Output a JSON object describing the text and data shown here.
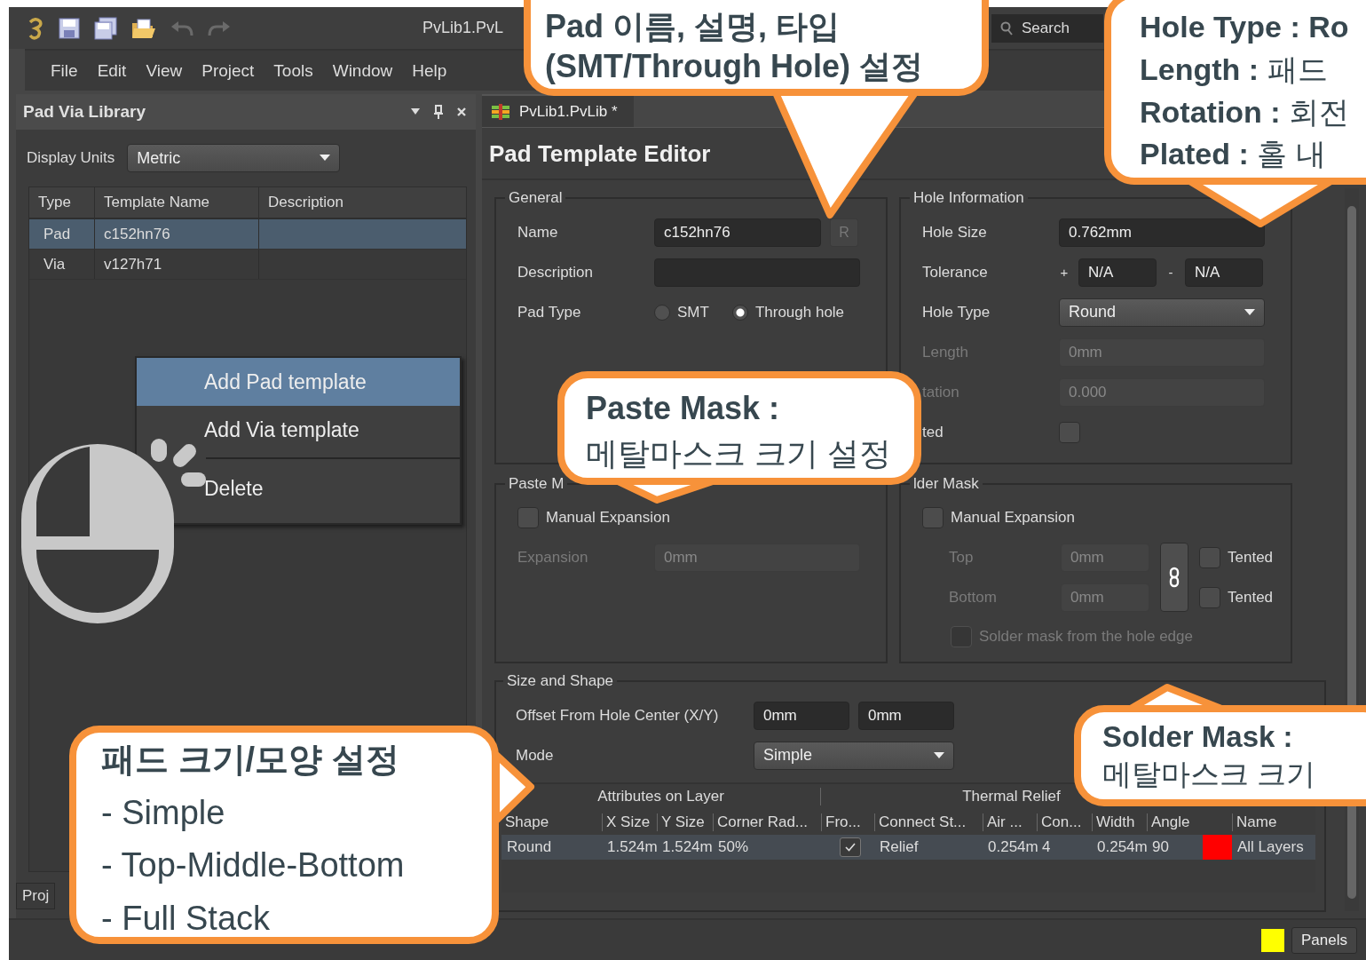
{
  "titlebar": {
    "title": "PvLib1.PvL",
    "search_placeholder": "Search"
  },
  "menu": [
    "File",
    "Edit",
    "View",
    "Project",
    "Tools",
    "Window",
    "Help"
  ],
  "panel": {
    "title": "Pad Via Library",
    "display_units_label": "Display Units",
    "display_units": "Metric",
    "columns": [
      "Type",
      "Template Name",
      "Description"
    ],
    "rows": [
      {
        "type": "Pad",
        "name": "c152hn76",
        "selected": true
      },
      {
        "type": "Via",
        "name": "v127h71",
        "selected": false
      }
    ],
    "bottom_tab": "Proj"
  },
  "context_menu": [
    {
      "label": "Add Pad template",
      "selected": true,
      "separator_before": false
    },
    {
      "label": "Add Via template",
      "selected": false,
      "separator_before": false
    },
    {
      "label": "Delete",
      "selected": false,
      "separator_before": true
    }
  ],
  "editor": {
    "tab": "PvLib1.PvLib *",
    "title": "Pad Template Editor",
    "general": {
      "title": "General",
      "name_label": "Name",
      "name": "c152hn76",
      "r_button": "R",
      "description_label": "Description",
      "pad_type_label": "Pad Type",
      "pad_types": [
        {
          "label": "SMT",
          "selected": false
        },
        {
          "label": "Through hole",
          "selected": true
        }
      ]
    },
    "hole": {
      "title": "Hole Information",
      "fields": [
        {
          "kind": "text",
          "label": "Hole Size",
          "value": "0.762mm",
          "disabled": false
        },
        {
          "kind": "tolerance",
          "label": "Tolerance",
          "plus": "+",
          "plus_value": "N/A",
          "minus": "-",
          "minus_value": "N/A"
        },
        {
          "kind": "dropdown",
          "label": "Hole Type",
          "value": "Round"
        },
        {
          "kind": "text",
          "label": "Length",
          "value": "0mm",
          "disabled": true
        },
        {
          "kind": "text",
          "label": "tation",
          "value": "0.000",
          "disabled": true
        },
        {
          "kind": "checkbox",
          "label": "ted",
          "checked": false
        }
      ]
    },
    "paste_mask": {
      "title": "Paste M",
      "manual_label": "Manual Expansion",
      "manual_checked": false,
      "expansion_label": "Expansion",
      "expansion": "0mm"
    },
    "solder_mask": {
      "title": "lder Mask",
      "manual_label": "Manual Expansion",
      "manual_checked": false,
      "rows": [
        {
          "label": "Top",
          "value": "0mm",
          "tented_label": "Tented",
          "tented": false
        },
        {
          "label": "Bottom",
          "value": "0mm",
          "tented_label": "Tented",
          "tented": false
        }
      ],
      "hole_edge_label": "Solder mask from the hole edge",
      "hole_edge_checked": false
    },
    "size_shape": {
      "title": "Size and Shape",
      "offset_label": "Offset From Hole Center (X/Y)",
      "offset_x": "0mm",
      "offset_y": "0mm",
      "mode_label": "Mode",
      "mode": "Simple"
    },
    "layer_table": {
      "groups": [
        "Attributes on Layer",
        "Thermal Relief"
      ],
      "columns": [
        "Shape",
        "X Size",
        "Y Size",
        "Corner Rad...",
        "Fro...",
        "Connect St...",
        "Air ...",
        "Con...",
        "Width",
        "Angle",
        "Name"
      ],
      "rows": [
        {
          "shape": "Round",
          "x_size": "1.524m",
          "y_size": "1.524m",
          "corner": "50%",
          "front_checked": true,
          "connect": "Relief",
          "air": "0.254m",
          "conductors": "4",
          "width": "0.254m",
          "angle": "90",
          "color": "#ff0000",
          "name": "All Layers"
        }
      ]
    }
  },
  "status_bar": {
    "color": "#ffff00",
    "panels_button": "Panels"
  },
  "callouts": [
    {
      "lines": [
        {
          "text": "Pad 이름, 설명, 타입",
          "bold": true
        },
        {
          "text": "(SMT/Through Hole) 설정",
          "bold": true
        }
      ]
    },
    {
      "lines": [
        {
          "text": "Hole Type : Ro",
          "bold": true
        },
        {
          "text": "**Length :** 패드",
          "bold": false
        },
        {
          "text": "**Rotation :** 회전",
          "bold": false
        },
        {
          "text": "**Plated :** 홀 내",
          "bold": false
        }
      ]
    },
    {
      "lines": [
        {
          "text": "Paste Mask :",
          "bold": true
        },
        {
          "text": "메탈마스크 크기 설정",
          "bold": false
        }
      ]
    },
    {
      "lines": [
        {
          "text": "패드 크기/모양 설정",
          "bold": true
        },
        {
          "text": "- Simple",
          "bold": false
        },
        {
          "text": "- Top-Middle-Bottom",
          "bold": false
        },
        {
          "text": "- Full Stack",
          "bold": false
        }
      ]
    },
    {
      "lines": [
        {
          "text": "Solder Mask :",
          "bold": true
        },
        {
          "text": "메탈마스크 크기",
          "bold": false
        }
      ]
    }
  ]
}
